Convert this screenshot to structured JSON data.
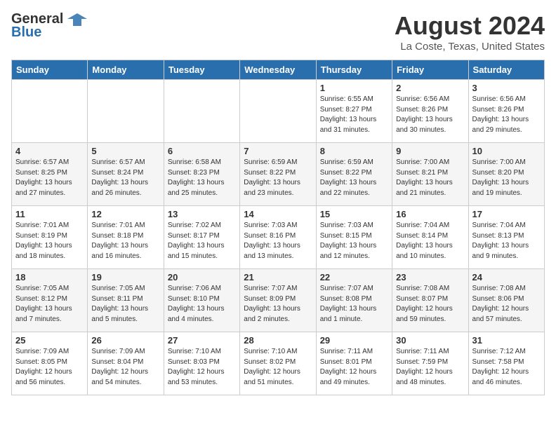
{
  "logo": {
    "general": "General",
    "blue": "Blue"
  },
  "title": "August 2024",
  "subtitle": "La Coste, Texas, United States",
  "headers": [
    "Sunday",
    "Monday",
    "Tuesday",
    "Wednesday",
    "Thursday",
    "Friday",
    "Saturday"
  ],
  "weeks": [
    [
      {
        "day": "",
        "info": ""
      },
      {
        "day": "",
        "info": ""
      },
      {
        "day": "",
        "info": ""
      },
      {
        "day": "",
        "info": ""
      },
      {
        "day": "1",
        "info": "Sunrise: 6:55 AM\nSunset: 8:27 PM\nDaylight: 13 hours\nand 31 minutes."
      },
      {
        "day": "2",
        "info": "Sunrise: 6:56 AM\nSunset: 8:26 PM\nDaylight: 13 hours\nand 30 minutes."
      },
      {
        "day": "3",
        "info": "Sunrise: 6:56 AM\nSunset: 8:26 PM\nDaylight: 13 hours\nand 29 minutes."
      }
    ],
    [
      {
        "day": "4",
        "info": "Sunrise: 6:57 AM\nSunset: 8:25 PM\nDaylight: 13 hours\nand 27 minutes."
      },
      {
        "day": "5",
        "info": "Sunrise: 6:57 AM\nSunset: 8:24 PM\nDaylight: 13 hours\nand 26 minutes."
      },
      {
        "day": "6",
        "info": "Sunrise: 6:58 AM\nSunset: 8:23 PM\nDaylight: 13 hours\nand 25 minutes."
      },
      {
        "day": "7",
        "info": "Sunrise: 6:59 AM\nSunset: 8:22 PM\nDaylight: 13 hours\nand 23 minutes."
      },
      {
        "day": "8",
        "info": "Sunrise: 6:59 AM\nSunset: 8:22 PM\nDaylight: 13 hours\nand 22 minutes."
      },
      {
        "day": "9",
        "info": "Sunrise: 7:00 AM\nSunset: 8:21 PM\nDaylight: 13 hours\nand 21 minutes."
      },
      {
        "day": "10",
        "info": "Sunrise: 7:00 AM\nSunset: 8:20 PM\nDaylight: 13 hours\nand 19 minutes."
      }
    ],
    [
      {
        "day": "11",
        "info": "Sunrise: 7:01 AM\nSunset: 8:19 PM\nDaylight: 13 hours\nand 18 minutes."
      },
      {
        "day": "12",
        "info": "Sunrise: 7:01 AM\nSunset: 8:18 PM\nDaylight: 13 hours\nand 16 minutes."
      },
      {
        "day": "13",
        "info": "Sunrise: 7:02 AM\nSunset: 8:17 PM\nDaylight: 13 hours\nand 15 minutes."
      },
      {
        "day": "14",
        "info": "Sunrise: 7:03 AM\nSunset: 8:16 PM\nDaylight: 13 hours\nand 13 minutes."
      },
      {
        "day": "15",
        "info": "Sunrise: 7:03 AM\nSunset: 8:15 PM\nDaylight: 13 hours\nand 12 minutes."
      },
      {
        "day": "16",
        "info": "Sunrise: 7:04 AM\nSunset: 8:14 PM\nDaylight: 13 hours\nand 10 minutes."
      },
      {
        "day": "17",
        "info": "Sunrise: 7:04 AM\nSunset: 8:13 PM\nDaylight: 13 hours\nand 9 minutes."
      }
    ],
    [
      {
        "day": "18",
        "info": "Sunrise: 7:05 AM\nSunset: 8:12 PM\nDaylight: 13 hours\nand 7 minutes."
      },
      {
        "day": "19",
        "info": "Sunrise: 7:05 AM\nSunset: 8:11 PM\nDaylight: 13 hours\nand 5 minutes."
      },
      {
        "day": "20",
        "info": "Sunrise: 7:06 AM\nSunset: 8:10 PM\nDaylight: 13 hours\nand 4 minutes."
      },
      {
        "day": "21",
        "info": "Sunrise: 7:07 AM\nSunset: 8:09 PM\nDaylight: 13 hours\nand 2 minutes."
      },
      {
        "day": "22",
        "info": "Sunrise: 7:07 AM\nSunset: 8:08 PM\nDaylight: 13 hours\nand 1 minute."
      },
      {
        "day": "23",
        "info": "Sunrise: 7:08 AM\nSunset: 8:07 PM\nDaylight: 12 hours\nand 59 minutes."
      },
      {
        "day": "24",
        "info": "Sunrise: 7:08 AM\nSunset: 8:06 PM\nDaylight: 12 hours\nand 57 minutes."
      }
    ],
    [
      {
        "day": "25",
        "info": "Sunrise: 7:09 AM\nSunset: 8:05 PM\nDaylight: 12 hours\nand 56 minutes."
      },
      {
        "day": "26",
        "info": "Sunrise: 7:09 AM\nSunset: 8:04 PM\nDaylight: 12 hours\nand 54 minutes."
      },
      {
        "day": "27",
        "info": "Sunrise: 7:10 AM\nSunset: 8:03 PM\nDaylight: 12 hours\nand 53 minutes."
      },
      {
        "day": "28",
        "info": "Sunrise: 7:10 AM\nSunset: 8:02 PM\nDaylight: 12 hours\nand 51 minutes."
      },
      {
        "day": "29",
        "info": "Sunrise: 7:11 AM\nSunset: 8:01 PM\nDaylight: 12 hours\nand 49 minutes."
      },
      {
        "day": "30",
        "info": "Sunrise: 7:11 AM\nSunset: 7:59 PM\nDaylight: 12 hours\nand 48 minutes."
      },
      {
        "day": "31",
        "info": "Sunrise: 7:12 AM\nSunset: 7:58 PM\nDaylight: 12 hours\nand 46 minutes."
      }
    ]
  ]
}
